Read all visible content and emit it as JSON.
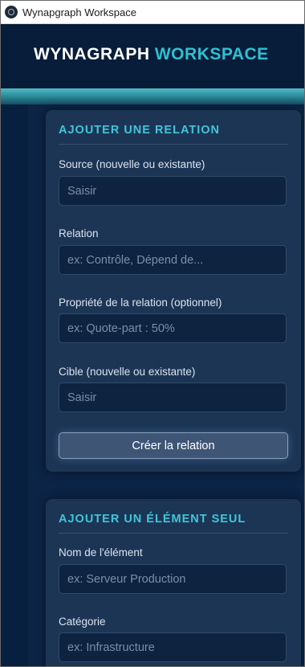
{
  "window": {
    "title": "Wynapgraph Workspace"
  },
  "header": {
    "brand_primary": "WYNAGRAPH",
    "brand_secondary": "WORKSPACE"
  },
  "relation_panel": {
    "title": "AJOUTER UNE RELATION",
    "source_label": "Source (nouvelle ou existante)",
    "source_placeholder": "Saisir",
    "relation_label": "Relation",
    "relation_placeholder": "ex: Contrôle, Dépend de...",
    "property_label": "Propriété de la relation (optionnel)",
    "property_placeholder": "ex: Quote-part : 50%",
    "target_label": "Cible (nouvelle ou existante)",
    "target_placeholder": "Saisir",
    "create_button": "Créer la relation"
  },
  "element_panel": {
    "title": "AJOUTER UN ÉLÉMENT SEUL",
    "name_label": "Nom de l'élément",
    "name_placeholder": "ex: Serveur Production",
    "category_label": "Catégorie",
    "category_placeholder": "ex: Infrastructure"
  }
}
